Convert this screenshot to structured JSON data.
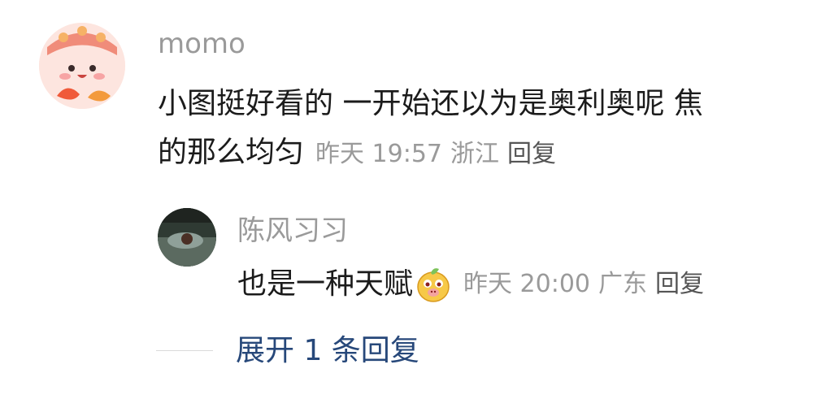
{
  "main_comment": {
    "username": "momo",
    "text_line1": "小图挺好看的  一开始还以为是奥利奥呢 焦",
    "text_line2": "的那么均匀",
    "time": "昨天 19:57",
    "location": "浙江",
    "reply_label": "回复"
  },
  "reply_comment": {
    "username": "陈风习习",
    "text": "也是一种天赋",
    "time": "昨天 20:00",
    "location": "广东",
    "reply_label": "回复"
  },
  "expand_label": "展开 1 条回复",
  "colors": {
    "username": "#9a9a9a",
    "text": "#1b1b1b",
    "meta": "#9a9a9a",
    "link": "#27487a"
  }
}
